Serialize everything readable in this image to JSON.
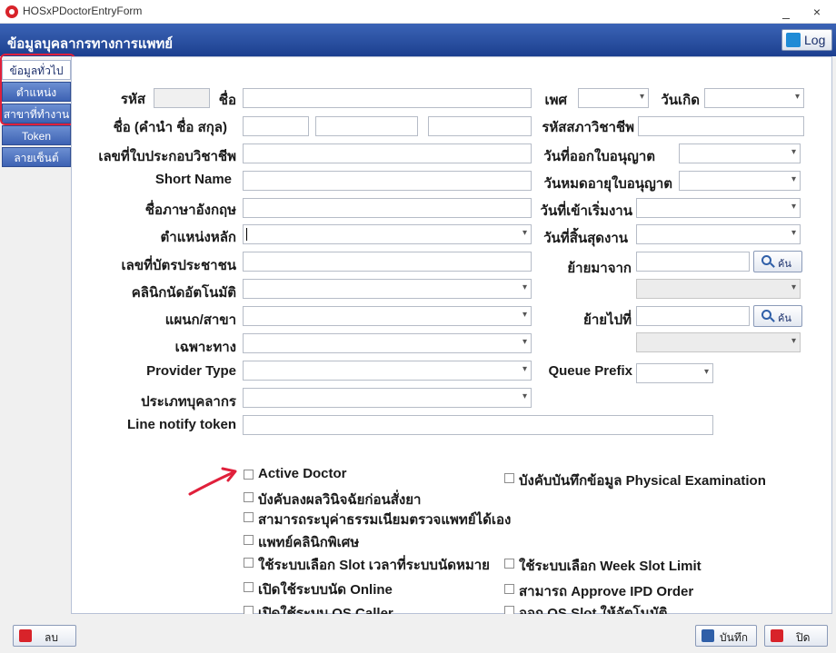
{
  "window": {
    "title": "HOSxPDoctorEntryForm",
    "minimize": "_",
    "close": "×"
  },
  "header": {
    "title": "ข้อมูลบุคลากรทางการแพทย์",
    "log_label": "Log"
  },
  "sidebar": {
    "tabs": [
      {
        "label": "ข้อมูลทั่วไป"
      },
      {
        "label": "ตำแหน่ง"
      },
      {
        "label": "สาขาที่ทำงาน"
      },
      {
        "label": "Token"
      },
      {
        "label": "ลายเซ็นต์"
      }
    ]
  },
  "form": {
    "code_label": "รหัส",
    "name_label": "ชื่อ",
    "sex_label": "เพศ",
    "birthdate_label": "วันเกิด",
    "fullname_label": "ชื่อ  (คำนำ ชื่อ สกุล)",
    "council_code_label": "รหัสสภาวิชาชีพ",
    "license_no_label": "เลขที่ใบประกอบวิชาชีพ",
    "license_issue_label": "วันที่ออกใบอนุญาต",
    "short_name_label": "Short Name",
    "license_expire_label": "วันหมดอายุใบอนุญาต",
    "english_name_label": "ชื่อภาษาอังกฤษ",
    "start_date_label": "วันที่เข้าเริ่มงาน",
    "main_position_label": "ตำแหน่งหลัก",
    "end_date_label": "วันที่สิ้นสุดงาน",
    "cid_label": "เลขที่บัตรประชาชน",
    "moved_from_label": "ย้ายมาจาก",
    "search_label": "ค้น",
    "auto_clinic_label": "คลินิกนัดอัตโนมัติ",
    "department_label": "แผนก/สาขา",
    "moved_to_label": "ย้ายไปที่",
    "specialty_label": "เฉพาะทาง",
    "provider_type_label": "Provider Type",
    "queue_prefix_label": "Queue Prefix",
    "staff_type_label": "ประเภทบุคลากร",
    "line_token_label": "Line notify token"
  },
  "options_left": [
    "Active Doctor",
    "บังคับลงผลวินิจฉัยก่อนสั่งยา",
    "สามารถระบุค่าธรรมเนียมตรวจแพทย์ได้เอง",
    "แพทย์คลินิกพิเศษ",
    "ใช้ระบบเลือก Slot เวลาที่ระบบนัดหมาย",
    "เปิดใช้ระบบนัด Online",
    "เปิดใช้ระบบ OS Caller"
  ],
  "options_right": [
    "บังคับบันทึกข้อมูล Physical Examination",
    "ใช้ระบบเลือก Week Slot Limit",
    "สามารถ Approve IPD Order",
    "ออก OS Slot ให้อัตโนมัติ"
  ],
  "footer": {
    "delete_label": "ลบ",
    "save_label": "บันทึก",
    "close_label": "ปิด"
  },
  "colors": {
    "header": "#2a4fa3",
    "annotation": "#e0203b"
  }
}
